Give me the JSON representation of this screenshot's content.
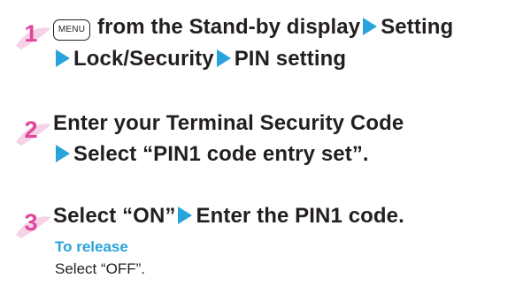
{
  "steps": [
    {
      "number": "1",
      "key_label": "MENU",
      "line1_text": "from the Stand-by display",
      "line1_item": "Setting",
      "line2_item1": "Lock/Security",
      "line2_item2": "PIN setting"
    },
    {
      "number": "2",
      "line1": "Enter your Terminal Security Code",
      "line2": "Select “PIN1 code entry set”."
    },
    {
      "number": "3",
      "line1_part1": "Select “ON”",
      "line1_part2": "Enter the PIN1 code."
    }
  ],
  "release": {
    "heading": "To release",
    "text": "Select “OFF”."
  },
  "colors": {
    "number": "#e0459a",
    "arrow": "#29a3db",
    "release_heading": "#29a3db",
    "text": "#231f20"
  }
}
